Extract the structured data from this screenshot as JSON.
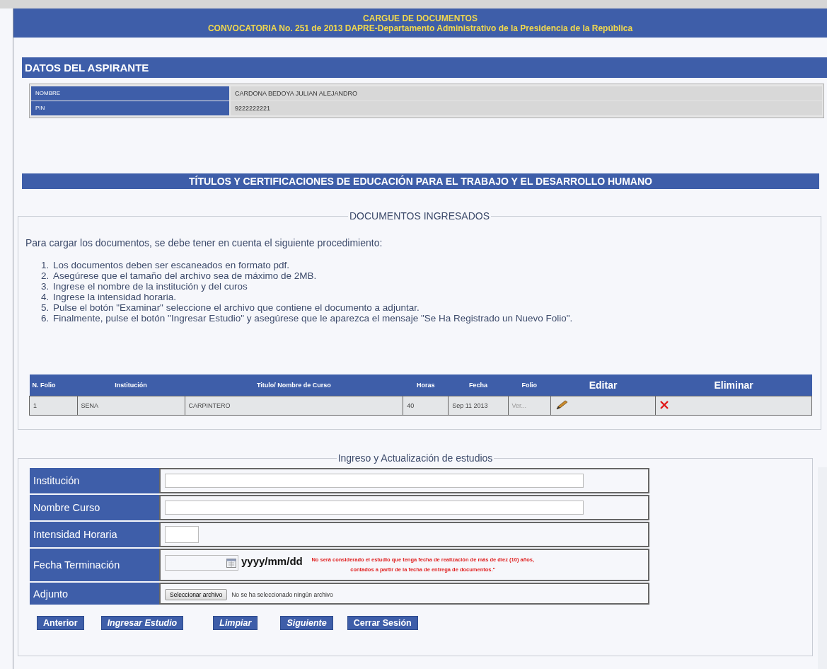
{
  "header": {
    "title": "CARGUE DE DOCUMENTOS",
    "subtitle": "CONVOCATORIA No. 251 de 2013 DAPRE-Departamento Administrativo de la Presidencia de la República"
  },
  "applicant": {
    "title": "DATOS DEL ASPIRANTE",
    "rows": [
      {
        "label": "NOMBRE",
        "value": "CARDONA BEDOYA JULIAN ALEJANDRO"
      },
      {
        "label": "PIN",
        "value": "9222222221"
      }
    ]
  },
  "section_title": "TÍTULOS Y CERTIFICACIONES DE EDUCACIÓN PARA EL TRABAJO Y EL DESARROLLO HUMANO",
  "documents": {
    "legend": "DOCUMENTOS INGRESADOS",
    "intro": "Para cargar los documentos, se debe tener en cuenta el siguiente procedimiento:",
    "steps": [
      {
        "number": "1.",
        "text": "Los documentos deben ser escaneados en formato pdf."
      },
      {
        "number": "2.",
        "text": "Asegúrese que el tamaño del archivo sea de máximo de 2MB."
      },
      {
        "number": "3.",
        "text": "Ingrese el nombre de la institución y del curos"
      },
      {
        "number": "4.",
        "text": "Ingrese la intensidad horaria."
      },
      {
        "number": "5.",
        "text": "Pulse el botón \"Examinar\" seleccione el archivo que contiene el documento a adjuntar."
      },
      {
        "number": "6.",
        "text": "Finalmente, pulse el botón \"Ingresar Estudio\" y asegúrese que le aparezca el mensaje \"Se Ha Registrado un Nuevo Folio\"."
      }
    ],
    "table": {
      "columns": [
        "N. Folio",
        "Institución",
        "Titulo/ Nombre de Curso",
        "Horas",
        "Fecha",
        "Folio",
        "Editar",
        "Eliminar"
      ],
      "rows": [
        {
          "folio_number": "1",
          "institution": "SENA",
          "course": "CARPINTERO",
          "hours": "40",
          "date": "Sep 11 2013",
          "folio_link": "Ver..."
        }
      ]
    }
  },
  "form": {
    "legend": "Ingreso y Actualización de estudios",
    "fields": [
      {
        "kind": "text",
        "label": "Institución"
      },
      {
        "kind": "text",
        "label": "Nombre Curso"
      },
      {
        "kind": "short",
        "label": "Intensidad Horaria"
      },
      {
        "kind": "date",
        "label": "Fecha Terminación",
        "format": "yyyy/mm/dd",
        "note": "No será considerado el estudio que tenga fecha de realización de más de diez (10)  años, contados a partir de la fecha de entrega de documentos.\""
      },
      {
        "kind": "file",
        "label": "Adjunto",
        "button": "Seleccionar archivo",
        "status": "No se ha seleccionado ningún archivo"
      }
    ],
    "buttons": [
      {
        "label": "Anterior",
        "italic": false
      },
      {
        "label": "Ingresar Estudio",
        "italic": true
      },
      {
        "label": "Limpiar",
        "italic": true
      },
      {
        "label": "Siguiente",
        "italic": true
      },
      {
        "label": "Cerrar Sesión",
        "italic": false
      }
    ]
  }
}
